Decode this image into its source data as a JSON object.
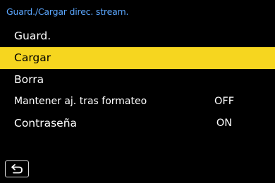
{
  "header": {
    "title": "Guard./Cargar direc. stream."
  },
  "menu": {
    "items": [
      {
        "label": "Guard.",
        "value": ""
      },
      {
        "label": "Cargar",
        "value": ""
      },
      {
        "label": "Borra",
        "value": ""
      },
      {
        "label": "Mantener aj. tras formateo",
        "value": "OFF"
      },
      {
        "label": "Contraseña",
        "value": "ON"
      }
    ],
    "selected_index": 1
  },
  "footer": {
    "back_icon": "return-icon"
  },
  "colors": {
    "title": "#5ba7ff",
    "highlight": "#f6d61f",
    "background": "#000000",
    "text": "#ffffff"
  }
}
